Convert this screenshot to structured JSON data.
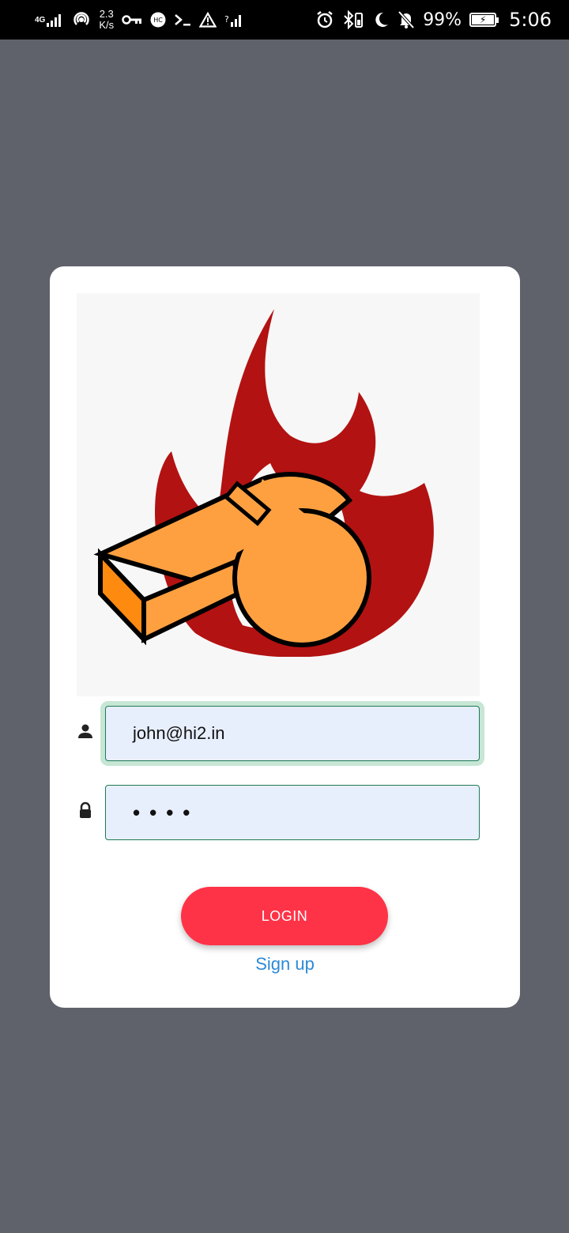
{
  "status_bar": {
    "network": "4G",
    "data_speed_value": "2.3",
    "data_speed_unit": "K/s",
    "battery": "99%",
    "time": "5:06",
    "icons": [
      "signal-icon",
      "hotspot-icon",
      "vpn-key-icon",
      "hc-icon",
      "terminal-icon",
      "warning-icon",
      "wifi-signal-icon",
      "alarm-icon",
      "bluetooth-icon",
      "moon-icon",
      "bell-off-icon",
      "battery-icon"
    ]
  },
  "login": {
    "email_value": "john@hi2.in",
    "password_mask": "••••",
    "login_label": "LOGIN",
    "signup_label": "Sign up"
  },
  "colors": {
    "background": "#5f626b",
    "card": "#ffffff",
    "input_bg": "#e8effc",
    "input_border": "#1d7a55",
    "login_button": "#ff3347",
    "signup_link": "#2d89d6",
    "flame": "#b31212",
    "whistle": "#ffa040"
  }
}
